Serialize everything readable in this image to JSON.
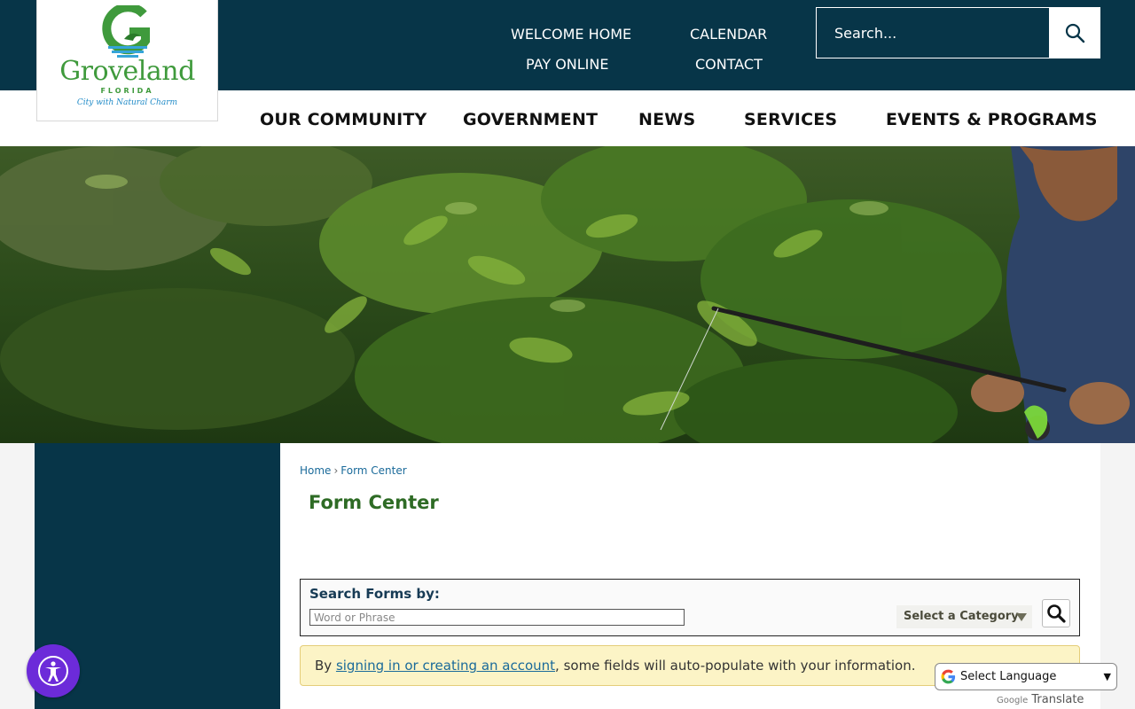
{
  "logo": {
    "wordmark": "Groveland",
    "state": "FLORIDA",
    "tagline": "City with Natural Charm"
  },
  "quick_links": [
    "WELCOME HOME",
    "CALENDAR",
    "PAY ONLINE",
    "CONTACT"
  ],
  "search": {
    "placeholder": "Search..."
  },
  "main_nav": [
    "OUR COMMUNITY",
    "GOVERNMENT",
    "NEWS",
    "SERVICES",
    "EVENTS & PROGRAMS"
  ],
  "breadcrumb": {
    "home": "Home",
    "separator": "›",
    "current": "Form Center"
  },
  "page_title": "Form Center",
  "search_forms": {
    "label": "Search Forms by:",
    "placeholder": "Word or Phrase",
    "category": "Select a Category"
  },
  "notice": {
    "prefix": "By ",
    "link": "signing in or creating an account",
    "suffix": ", some fields will auto-populate with your information."
  },
  "translate": {
    "select_label": "Select Language",
    "powered_brand": "Google",
    "powered_text": "Translate"
  },
  "colors": {
    "header_navy": "#073548",
    "title_green": "#2e6b25",
    "link_blue": "#1a6a9a",
    "notice_bg": "#fcf4c6",
    "accessibility_purple": "#6c2bd9"
  }
}
